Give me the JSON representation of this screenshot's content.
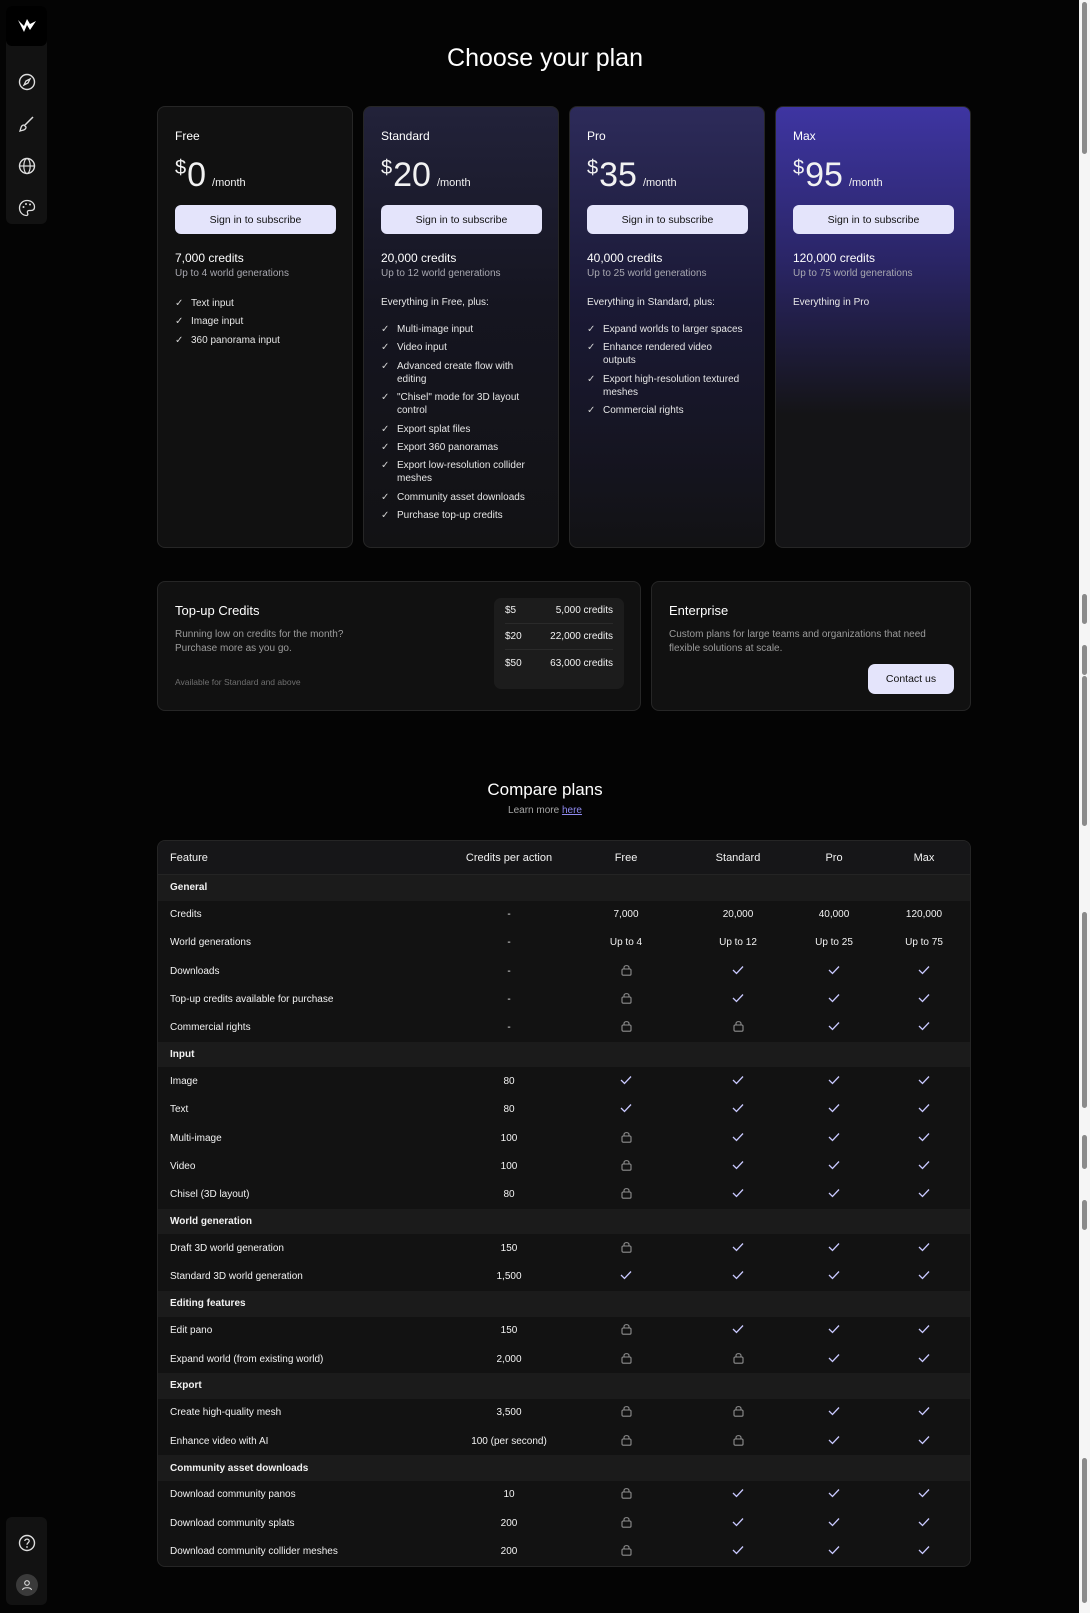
{
  "page": {
    "title": "Choose your plan"
  },
  "sidebar": {
    "icons": [
      "logo-icon",
      "compass-icon",
      "brush-icon",
      "globe-icon",
      "palette-icon"
    ],
    "bottom_icons": [
      "help-icon",
      "profile-icon"
    ]
  },
  "plans": [
    {
      "name": "Free",
      "currency": "$",
      "price": "0",
      "period": "/month",
      "button": "Sign in to subscribe",
      "credits": "7,000 credits",
      "generations": "Up to 4 world generations",
      "everything": "",
      "features": [
        "Text input",
        "Image input",
        "360 panorama input"
      ]
    },
    {
      "name": "Standard",
      "currency": "$",
      "price": "20",
      "period": "/month",
      "button": "Sign in to subscribe",
      "credits": "20,000 credits",
      "generations": "Up to 12 world generations",
      "everything": "Everything in Free, plus:",
      "features": [
        "Multi-image input",
        "Video input",
        "Advanced create flow with editing",
        "\"Chisel\" mode for 3D layout control",
        "Export splat files",
        "Export 360 panoramas",
        "Export low-resolution collider meshes",
        "Community asset downloads",
        "Purchase top-up credits"
      ]
    },
    {
      "name": "Pro",
      "currency": "$",
      "price": "35",
      "period": "/month",
      "button": "Sign in to subscribe",
      "credits": "40,000 credits",
      "generations": "Up to 25 world generations",
      "everything": "Everything in Standard, plus:",
      "features": [
        "Expand worlds to larger spaces",
        "Enhance rendered video outputs",
        "Export high-resolution textured meshes",
        "Commercial rights"
      ]
    },
    {
      "name": "Max",
      "currency": "$",
      "price": "95",
      "period": "/month",
      "button": "Sign in to subscribe",
      "credits": "120,000 credits",
      "generations": "Up to 75 world generations",
      "everything": "Everything in Pro",
      "features": []
    }
  ],
  "topup": {
    "title": "Top-up Credits",
    "description": "Running low on credits for the month? Purchase more as you go.",
    "note": "Available for Standard and above",
    "options": [
      {
        "price": "$5",
        "credits": "5,000 credits"
      },
      {
        "price": "$20",
        "credits": "22,000 credits"
      },
      {
        "price": "$50",
        "credits": "63,000 credits"
      }
    ]
  },
  "enterprise": {
    "title": "Enterprise",
    "description": "Custom plans for large teams and organizations that need flexible solutions at scale.",
    "button": "Contact us"
  },
  "compare": {
    "title": "Compare plans",
    "learn_prefix": "Learn more ",
    "learn_link": "here",
    "headers": [
      "Feature",
      "Credits per action",
      "Free",
      "Standard",
      "Pro",
      "Max"
    ],
    "sections": [
      {
        "name": "General",
        "rows": [
          {
            "feature": "Credits",
            "credits": "-",
            "values": [
              "7,000",
              "20,000",
              "40,000",
              "120,000"
            ]
          },
          {
            "feature": "World generations",
            "credits": "-",
            "values": [
              "Up to 4",
              "Up to 12",
              "Up to 25",
              "Up to 75"
            ]
          },
          {
            "feature": "Downloads",
            "credits": "-",
            "values": [
              "lock",
              "check",
              "check",
              "check"
            ]
          },
          {
            "feature": "Top-up credits available for purchase",
            "credits": "-",
            "values": [
              "lock",
              "check",
              "check",
              "check"
            ]
          },
          {
            "feature": "Commercial rights",
            "credits": "-",
            "values": [
              "lock",
              "lock",
              "check",
              "check"
            ]
          }
        ]
      },
      {
        "name": "Input",
        "rows": [
          {
            "feature": "Image",
            "credits": "80",
            "values": [
              "check",
              "check",
              "check",
              "check"
            ]
          },
          {
            "feature": "Text",
            "credits": "80",
            "values": [
              "check",
              "check",
              "check",
              "check"
            ]
          },
          {
            "feature": "Multi-image",
            "credits": "100",
            "values": [
              "lock",
              "check",
              "check",
              "check"
            ]
          },
          {
            "feature": "Video",
            "credits": "100",
            "values": [
              "lock",
              "check",
              "check",
              "check"
            ]
          },
          {
            "feature": "Chisel (3D layout)",
            "credits": "80",
            "values": [
              "lock",
              "check",
              "check",
              "check"
            ]
          }
        ]
      },
      {
        "name": "World generation",
        "rows": [
          {
            "feature": "Draft 3D world generation",
            "credits": "150",
            "values": [
              "lock",
              "check",
              "check",
              "check"
            ]
          },
          {
            "feature": "Standard 3D world generation",
            "credits": "1,500",
            "values": [
              "check",
              "check",
              "check",
              "check"
            ]
          }
        ]
      },
      {
        "name": "Editing features",
        "rows": [
          {
            "feature": "Edit pano",
            "credits": "150",
            "values": [
              "lock",
              "check",
              "check",
              "check"
            ]
          },
          {
            "feature": "Expand world (from existing world)",
            "credits": "2,000",
            "values": [
              "lock",
              "lock",
              "check",
              "check"
            ]
          }
        ]
      },
      {
        "name": "Export",
        "rows": [
          {
            "feature": "Create high-quality mesh",
            "credits": "3,500",
            "values": [
              "lock",
              "lock",
              "check",
              "check"
            ]
          },
          {
            "feature": "Enhance video with AI",
            "credits": "100 (per second)",
            "values": [
              "lock",
              "lock",
              "check",
              "check"
            ]
          }
        ]
      },
      {
        "name": "Community asset downloads",
        "rows": [
          {
            "feature": "Download community panos",
            "credits": "10",
            "values": [
              "lock",
              "check",
              "check",
              "check"
            ]
          },
          {
            "feature": "Download community splats",
            "credits": "200",
            "values": [
              "lock",
              "check",
              "check",
              "check"
            ]
          },
          {
            "feature": "Download community collider meshes",
            "credits": "200",
            "values": [
              "lock",
              "check",
              "check",
              "check"
            ]
          }
        ]
      }
    ]
  }
}
